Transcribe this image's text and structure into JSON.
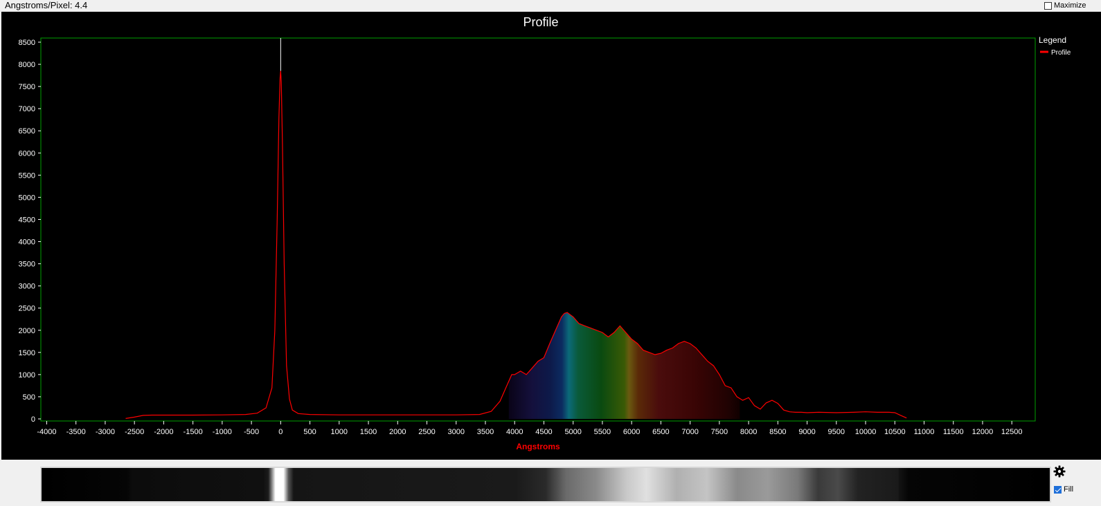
{
  "header": {
    "angstroms_per_pixel_label": "Angstroms/Pixel: 4.4",
    "maximize_label": "Maximize",
    "maximize_checked": false
  },
  "controls": {
    "fill_label": "Fill",
    "fill_checked": true,
    "settings_icon": "gear-icon"
  },
  "colors": {
    "background": "#000000",
    "plot_border": "#00a000",
    "series": "#ff0000",
    "axis_title": "#ff0000",
    "marker_line": "#ffffff"
  },
  "chart_data": {
    "type": "line",
    "title": "Profile",
    "xlabel": "Angstroms",
    "ylabel": "",
    "xlim": [
      -4100,
      12900
    ],
    "ylim": [
      0,
      8600
    ],
    "x_ticks": [
      -4000,
      -3500,
      -3000,
      -2500,
      -2000,
      -1500,
      -1000,
      -500,
      0,
      500,
      1000,
      1500,
      2000,
      2500,
      3000,
      3500,
      4000,
      4500,
      5000,
      5500,
      6000,
      6500,
      7000,
      7500,
      8000,
      8500,
      9000,
      9500,
      10000,
      10500,
      11000,
      11500,
      12000,
      12500
    ],
    "y_ticks": [
      0,
      500,
      1000,
      1500,
      2000,
      2500,
      3000,
      3500,
      4000,
      4500,
      5000,
      5500,
      6000,
      6500,
      7000,
      7500,
      8000,
      8500
    ],
    "legend": {
      "title": "Legend",
      "position": "top-right",
      "entries": [
        "Profile"
      ]
    },
    "marker_x": 0,
    "fill": "spectrum-gradient",
    "series": [
      {
        "name": "Profile",
        "x": [
          -2650,
          -2500,
          -2350,
          -2200,
          -2000,
          -1500,
          -1000,
          -600,
          -400,
          -250,
          -150,
          -100,
          -60,
          -30,
          -10,
          0,
          10,
          30,
          60,
          100,
          150,
          200,
          300,
          500,
          1000,
          1500,
          2000,
          2500,
          3000,
          3400,
          3600,
          3750,
          3850,
          3950,
          4000,
          4100,
          4200,
          4300,
          4400,
          4500,
          4600,
          4700,
          4800,
          4850,
          4900,
          4950,
          5000,
          5100,
          5200,
          5300,
          5400,
          5500,
          5600,
          5700,
          5800,
          5900,
          6000,
          6100,
          6200,
          6300,
          6400,
          6500,
          6600,
          6700,
          6800,
          6900,
          7000,
          7100,
          7200,
          7300,
          7400,
          7500,
          7600,
          7700,
          7800,
          7900,
          8000,
          8100,
          8200,
          8300,
          8400,
          8500,
          8600,
          8700,
          8800,
          8900,
          9000,
          9200,
          9500,
          9800,
          10000,
          10200,
          10400,
          10500,
          10600,
          10700
        ],
        "y": [
          10,
          40,
          80,
          85,
          85,
          85,
          90,
          100,
          130,
          250,
          700,
          2000,
          4500,
          6800,
          7700,
          7850,
          7600,
          6200,
          3500,
          1200,
          450,
          200,
          120,
          100,
          90,
          90,
          90,
          90,
          90,
          100,
          170,
          400,
          700,
          1000,
          1000,
          1080,
          1000,
          1150,
          1300,
          1380,
          1700,
          2000,
          2300,
          2380,
          2400,
          2350,
          2300,
          2150,
          2100,
          2050,
          2000,
          1950,
          1850,
          1950,
          2100,
          1950,
          1800,
          1700,
          1550,
          1500,
          1450,
          1480,
          1550,
          1600,
          1700,
          1750,
          1700,
          1600,
          1450,
          1300,
          1200,
          1000,
          750,
          700,
          500,
          420,
          480,
          300,
          220,
          360,
          420,
          350,
          200,
          160,
          150,
          150,
          140,
          150,
          140,
          150,
          160,
          150,
          150,
          140,
          80,
          20
        ]
      }
    ]
  }
}
